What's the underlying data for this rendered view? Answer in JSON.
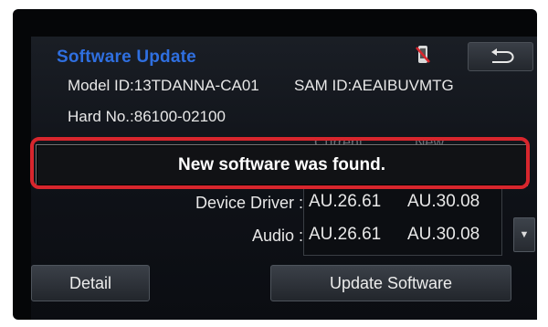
{
  "screen": {
    "title": "Software Update",
    "model_id": "Model ID:13TDANNA-CA01",
    "sam_id": "SAM ID:AEAIBUVMTG",
    "hard_no": "Hard No.:86100-02100",
    "col_current": "Current",
    "col_new": "New"
  },
  "rows": [
    {
      "label": "Device Driver :",
      "current": "AU.26.61",
      "new": "AU.30.08"
    },
    {
      "label": "Audio :",
      "current": "AU.26.61",
      "new": "AU.30.08"
    }
  ],
  "banner": {
    "message": "New software was found."
  },
  "buttons": {
    "detail": "Detail",
    "update": "Update Software",
    "scroll_down": "▼"
  },
  "icons": {
    "phone": "phone-disconnected-icon",
    "back": "back-arrow-icon"
  },
  "colors": {
    "title": "#2f6fe0",
    "highlight": "#d8262d",
    "background": "#0f1218"
  }
}
